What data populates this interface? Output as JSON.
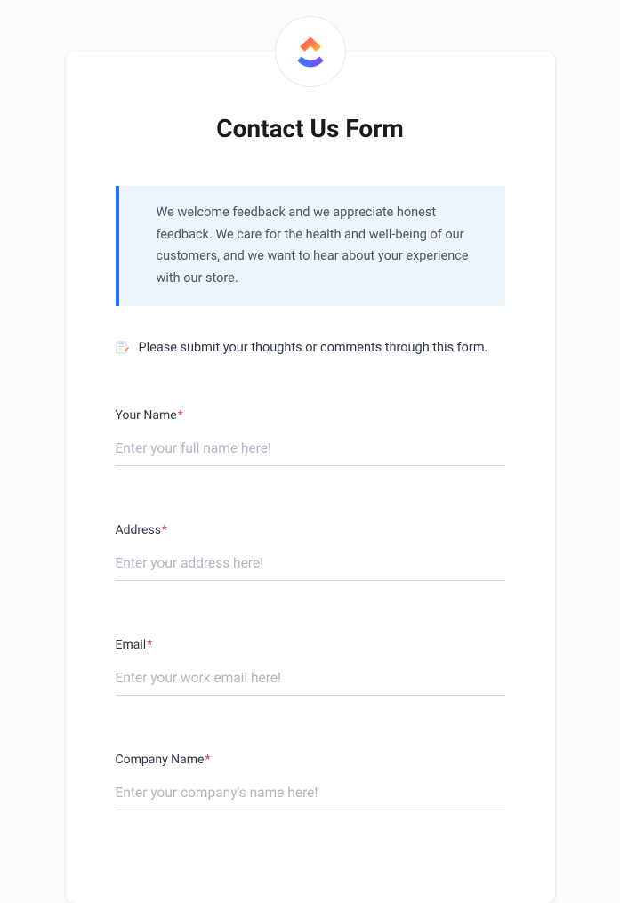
{
  "header": {
    "title": "Contact Us Form"
  },
  "welcome": {
    "text": "We welcome feedback and we appreciate honest feedback. We care for the health and well-being of our customers, and we want to hear about your experience with our store."
  },
  "prompt": {
    "text": "Please submit your thoughts or comments through this form."
  },
  "fields": [
    {
      "label": "Your Name",
      "required": true,
      "placeholder": "Enter your full name here!"
    },
    {
      "label": "Address",
      "required": true,
      "placeholder": "Enter your address here!"
    },
    {
      "label": "Email",
      "required": true,
      "placeholder": "Enter your work email here!"
    },
    {
      "label": "Company Name",
      "required": true,
      "placeholder": "Enter your company's name here!"
    }
  ],
  "required_marker": "*"
}
